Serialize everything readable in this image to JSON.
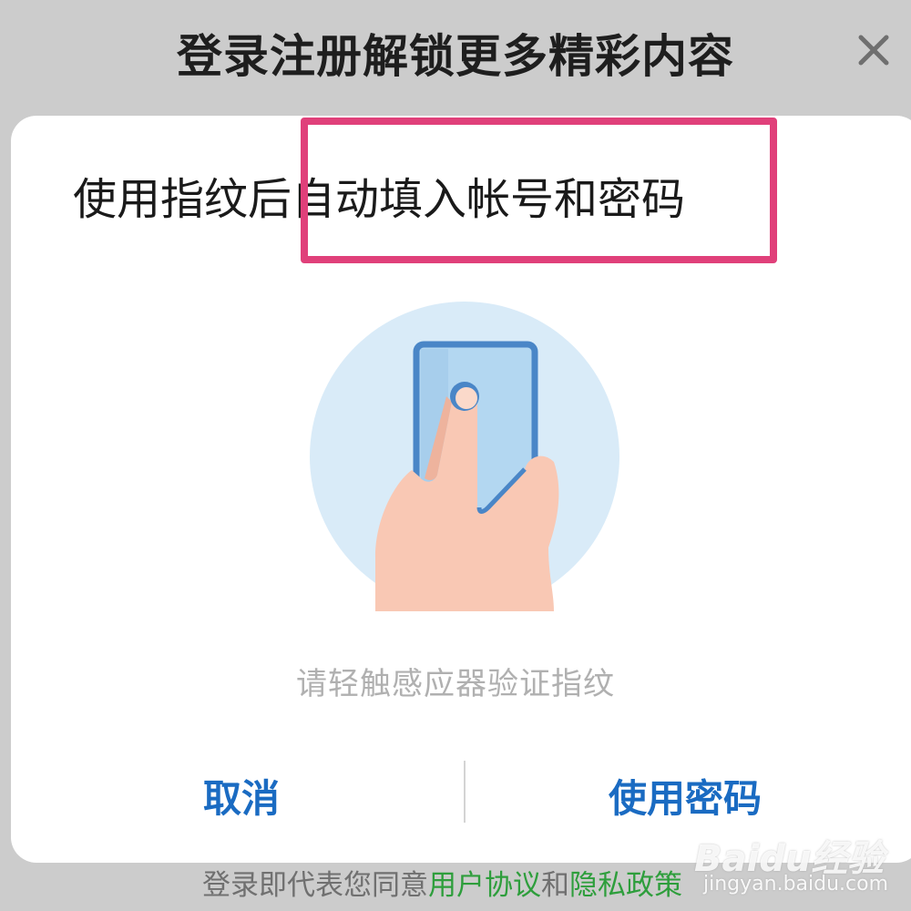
{
  "header": {
    "title": "登录注册解锁更多精彩内容",
    "close_icon": "close-icon"
  },
  "dialog": {
    "title": "使用指纹后自动填入帐号和密码",
    "illustration_icon": "fingerprint-touch-icon",
    "hint": "请轻触感应器验证指纹",
    "cancel_label": "取消",
    "use_password_label": "使用密码"
  },
  "footer": {
    "prefix": "登录即代表您同意",
    "user_agreement": "用户协议",
    "conjunction": "和",
    "privacy_policy": "隐私政策"
  },
  "watermark": {
    "text": "Baidu经验",
    "url": "jingyan.baidu.com"
  },
  "colors": {
    "highlight": "#e0407a",
    "button": "#1a6bc2",
    "link": "#2e9e3c",
    "overlay": "#cccccc"
  }
}
